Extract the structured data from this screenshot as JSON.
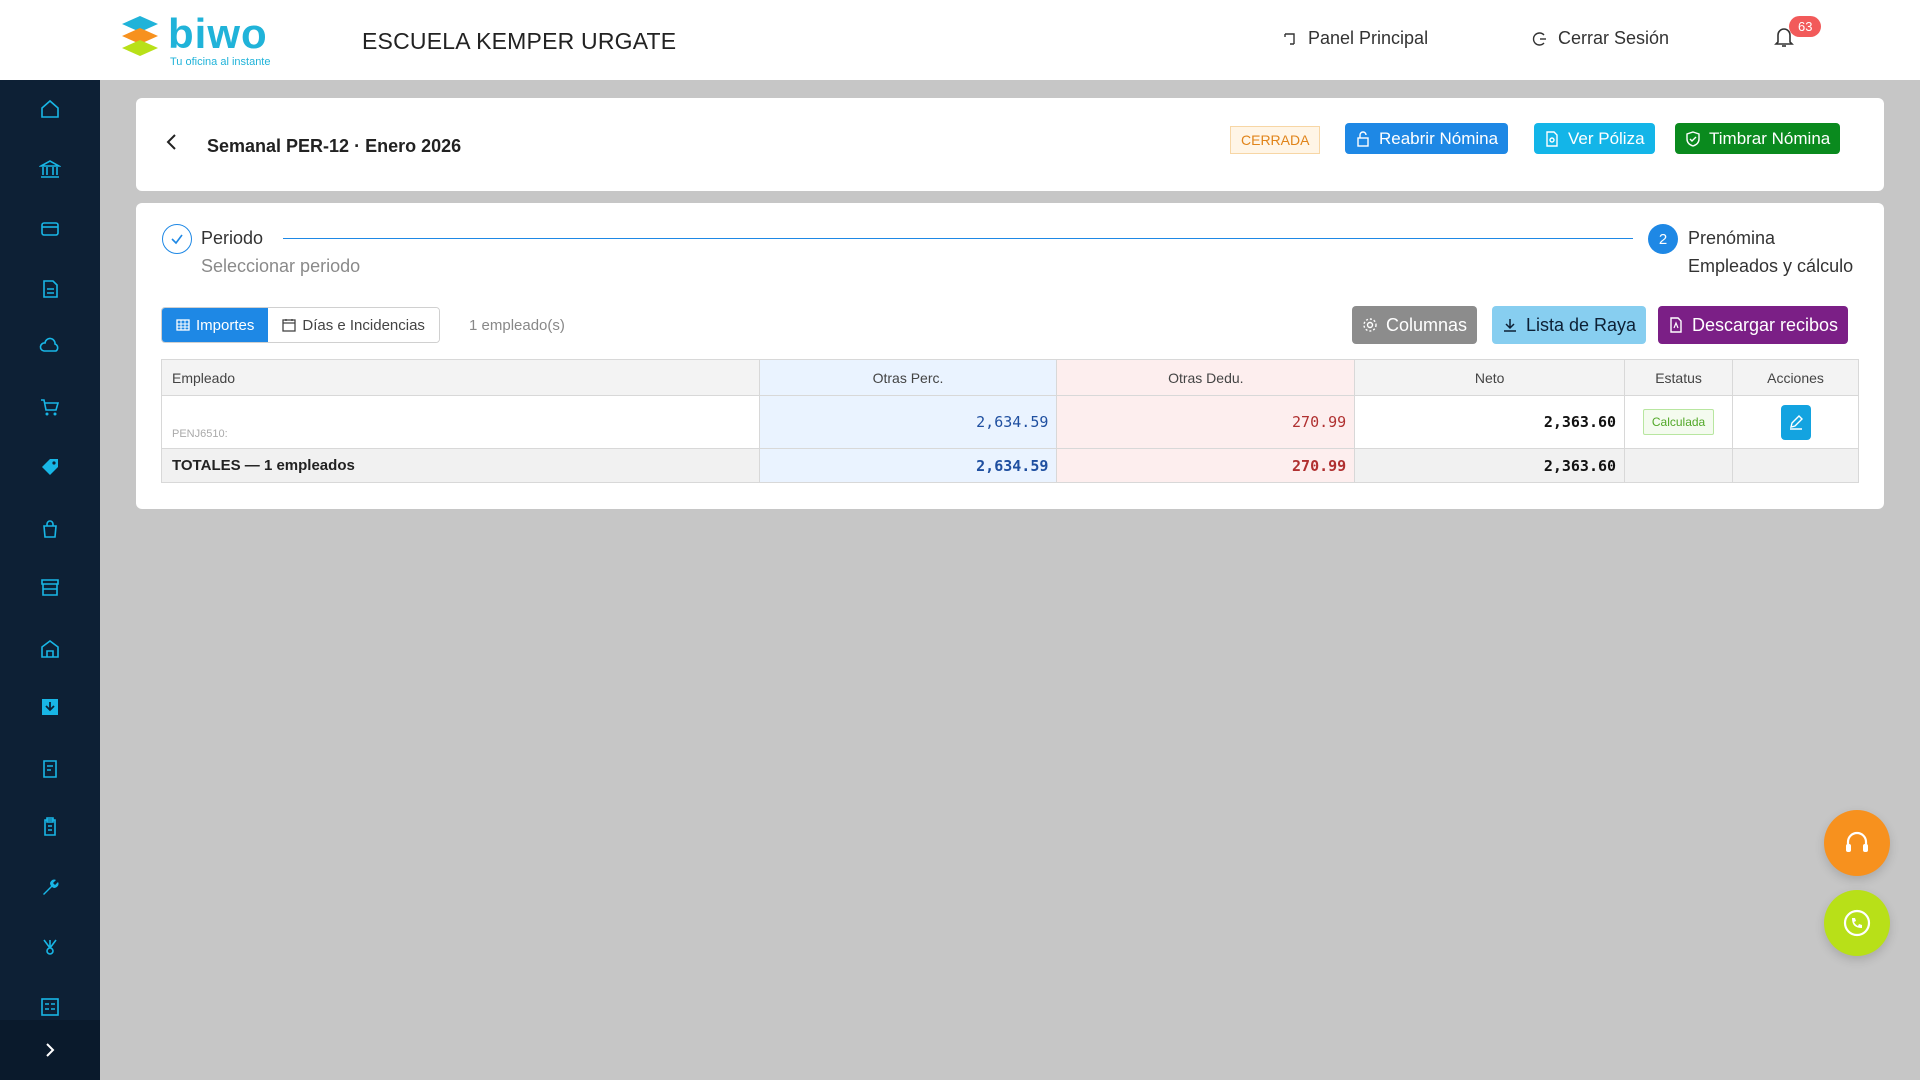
{
  "brand": {
    "name": "biwo",
    "tagline": "Tu oficina al instante"
  },
  "header": {
    "company": "ESCUELA KEMPER URGATE",
    "panel_label": "Panel Principal",
    "logout_label": "Cerrar Sesión",
    "notifications_count": "63"
  },
  "sidebar": {
    "items": [
      "home-icon",
      "bank-icon",
      "card-transfer-icon",
      "document-icon",
      "cloud-icon",
      "cart-icon",
      "tag-icon",
      "bag-icon",
      "store-icon",
      "warehouse-icon",
      "inbox-icon",
      "receipt-icon",
      "clipboard-icon",
      "wrench-icon",
      "network-icon",
      "calculator-icon"
    ],
    "expand_icon": "chevron-right-icon"
  },
  "page": {
    "title": "Semanal PER-12 · Enero 2026",
    "status": "CERRADA",
    "reopen_label": "Reabrir Nómina",
    "view_policy_label": "Ver Póliza",
    "stamp_label": "Timbrar Nómina"
  },
  "stepper": {
    "step1_title": "Periodo",
    "step1_sub": "Seleccionar periodo",
    "step2_number": "2",
    "step2_title": "Prenómina",
    "step2_sub": "Empleados y cálculo"
  },
  "toolbar": {
    "tab_amounts": "Importes",
    "tab_days": "Días e Incidencias",
    "employee_count": "1 empleado(s)",
    "columns_label": "Columnas",
    "payroll_list_label": "Lista de Raya",
    "download_receipts_label": "Descargar recibos"
  },
  "table": {
    "headers": [
      "Empleado",
      "Otras Perc.",
      "Otras Dedu.",
      "Neto",
      "Estatus",
      "Acciones"
    ],
    "rows": [
      {
        "employee_id": "PENJ6510:",
        "other_perc": "2,634.59",
        "other_dedu": "270.99",
        "net": "2,363.60",
        "status": "Calculada"
      }
    ],
    "totals": {
      "label": "TOTALES — 1 empleados",
      "other_perc": "2,634.59",
      "other_dedu": "270.99",
      "net": "2,363.60"
    }
  },
  "colors": {
    "sidebar": "#0d2035",
    "primary": "#1e88e5",
    "cyan": "#13b5e8",
    "green": "#0a8a1e",
    "purple": "#7b1f86",
    "orange": "#f7911e",
    "lime": "#b8e018"
  }
}
